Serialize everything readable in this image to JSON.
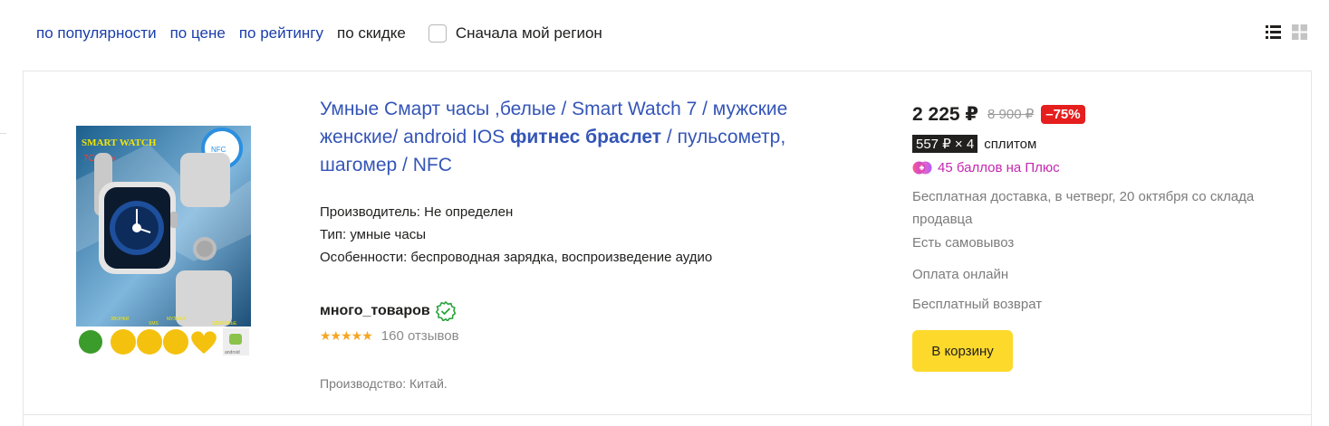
{
  "sort": {
    "options": [
      {
        "label": "по популярности",
        "active": false
      },
      {
        "label": "по цене",
        "active": false
      },
      {
        "label": "по рейтингу",
        "active": false
      },
      {
        "label": "по скидке",
        "active": true
      }
    ],
    "region_checkbox": {
      "label": "Сначала мой регион",
      "checked": false
    }
  },
  "view_switch": {
    "list_icon": "list-view-icon",
    "grid_icon": "grid-view-icon",
    "active": "list"
  },
  "product": {
    "title_before": "Умные Смарт часы ,белые / Smart Watch 7 / мужские женские/ android IOS ",
    "title_highlight": "фитнес браслет",
    "title_after": " / пульсометр, шагомер / NFC",
    "specs": [
      "Производитель: Не определен",
      "Тип: умные часы",
      "Особенности: беспроводная зарядка, воспроизведение аудио"
    ],
    "shop": {
      "name": "много_товаров",
      "verified_icon": "verified-check-icon"
    },
    "rating": {
      "stars": "★★★★★",
      "value": 5,
      "reviews": "160 отзывов"
    },
    "origin": "Производство: Китай.",
    "image": {
      "brand_text": "SMART WATCH",
      "series_text": "7Серии",
      "nfc_text": "NFC",
      "feature_labels": [
        "ЗВОНКИ",
        "SMS",
        "МУЗЫКА",
        "ЗДОРОВЬЕ"
      ],
      "android_text": "android"
    }
  },
  "offer": {
    "price": "2 225 ₽",
    "old_price": "8 900 ₽",
    "discount": "–75%",
    "split_badge": "557 ₽ × 4",
    "split_label": "сплитом",
    "plus_points": "45 баллов на Плюс",
    "delivery": "Бесплатная доставка, в четверг, 20 октября  со склада продавца",
    "pickup": "Есть самовывоз",
    "payment": "Оплата онлайн",
    "returns": "Бесплатный возврат",
    "cart_button": "В корзину",
    "colors": {
      "discount": "#e51e1e",
      "cart": "#fdd92b",
      "plus": "#c427b0",
      "link": "#1a3dab"
    }
  }
}
